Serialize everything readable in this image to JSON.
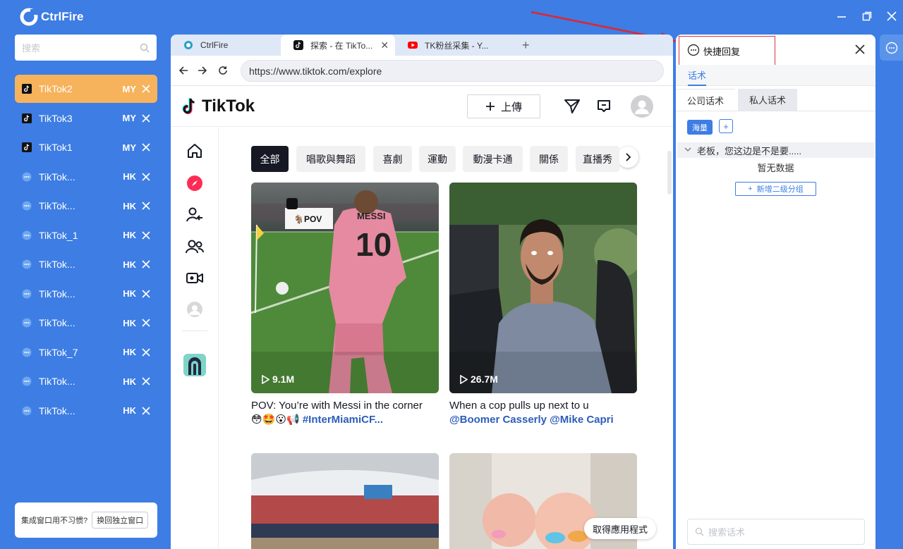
{
  "app": {
    "name": "CtrlFire"
  },
  "sidebar": {
    "search_placeholder": "搜索",
    "accounts": [
      {
        "name": "TikTok2",
        "region": "MY",
        "icon": "tiktok-icon",
        "active": true
      },
      {
        "name": "TikTok3",
        "region": "MY",
        "icon": "tiktok-icon",
        "active": false
      },
      {
        "name": "TikTok1",
        "region": "MY",
        "icon": "tiktok-icon",
        "active": false
      },
      {
        "name": "TikTok...",
        "region": "HK",
        "icon": "chat-bubble-icon",
        "active": false
      },
      {
        "name": "TikTok...",
        "region": "HK",
        "icon": "chat-bubble-icon",
        "active": false
      },
      {
        "name": "TikTok_1",
        "region": "HK",
        "icon": "chat-bubble-icon",
        "active": false
      },
      {
        "name": "TikTok...",
        "region": "HK",
        "icon": "chat-bubble-icon",
        "active": false
      },
      {
        "name": "TikTok...",
        "region": "HK",
        "icon": "chat-bubble-icon",
        "active": false
      },
      {
        "name": "TikTok...",
        "region": "HK",
        "icon": "chat-bubble-icon",
        "active": false
      },
      {
        "name": "TikTok_7",
        "region": "HK",
        "icon": "chat-bubble-icon",
        "active": false
      },
      {
        "name": "TikTok...",
        "region": "HK",
        "icon": "chat-bubble-icon",
        "active": false
      },
      {
        "name": "TikTok...",
        "region": "HK",
        "icon": "chat-bubble-icon",
        "active": false
      }
    ],
    "footer_text": "集成窗口用不习惯?",
    "footer_button": "换回独立窗口"
  },
  "browser": {
    "tabs": [
      {
        "title": "CtrlFire",
        "icon": "ctrlfire-icon",
        "active": false
      },
      {
        "title": "探索 - 在 TikTo...",
        "icon": "tiktok-icon",
        "active": true
      },
      {
        "title": "TK粉丝采集 - Y...",
        "icon": "youtube-icon",
        "active": false
      }
    ],
    "new_tab": "+",
    "url": "https://www.tiktok.com/explore"
  },
  "tiktok": {
    "logo_text": "TikTok",
    "upload_label": "上傳",
    "categories": [
      "全部",
      "唱歌與舞蹈",
      "喜劇",
      "運動",
      "動漫卡通",
      "關係",
      "直播秀"
    ],
    "videos": [
      {
        "views": "9.1M",
        "caption": "POV: You’re with Messi in the corner",
        "caption2_emoji": "😳🤩😮📢",
        "caption2_tag": "#InterMiamiCF...",
        "overlay_text": "🐐POV",
        "jersey": "MESSI 10"
      },
      {
        "views": "26.7M",
        "caption": "When a cop pulls up next to u",
        "caption2_emoji": "",
        "caption2_tag": "@Boomer Casserly @Mike Capri"
      }
    ],
    "get_app": "取得應用程式"
  },
  "quick_reply": {
    "title": "快捷回复",
    "tab": "话术",
    "subtabs": [
      "公司话术",
      "私人话术"
    ],
    "mass_button": "海量",
    "add_button": "+",
    "group_title": "老板，您这边是不是要.....",
    "empty_text": "暂无数据",
    "add_group": "新增二级分组",
    "search_placeholder": "搜索话术"
  },
  "colors": {
    "brand": "#3d7de4",
    "active_account": "#f7b25c",
    "highlight_box": "#d9363e",
    "arrow": "#e0262e"
  }
}
